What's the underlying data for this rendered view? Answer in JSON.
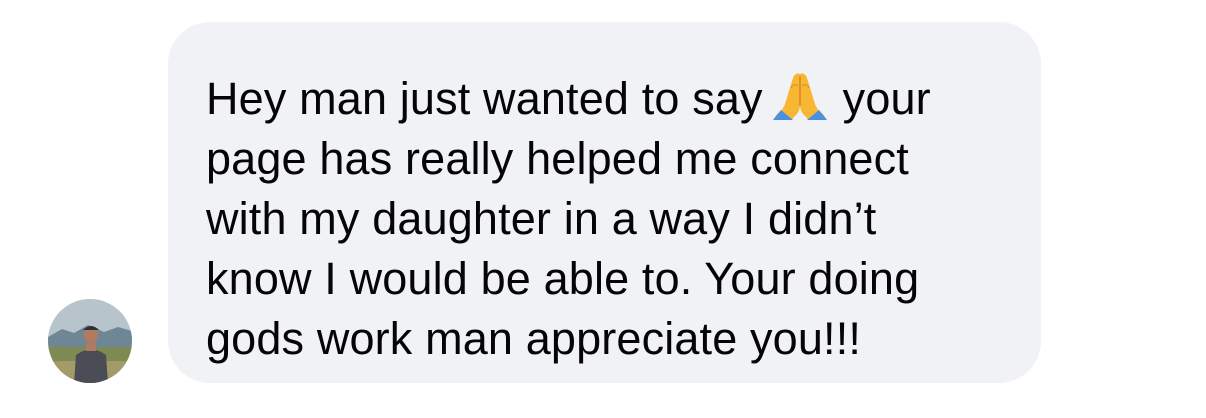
{
  "message": {
    "sender_avatar_icon": "profile-photo",
    "lines": [
      {
        "before_emoji": "Hey man just wanted to say",
        "emoji": "folded-hands-icon",
        "after_emoji": "your"
      },
      {
        "text": "page has really helped me connect"
      },
      {
        "text": "with my daughter in a way I didn’t"
      },
      {
        "text": "know I would be able to. Your doing"
      },
      {
        "text": "gods work man appreciate you!!!"
      }
    ]
  },
  "colors": {
    "bubble": "#f0f2f5",
    "text": "#050505",
    "background": "#ffffff"
  }
}
